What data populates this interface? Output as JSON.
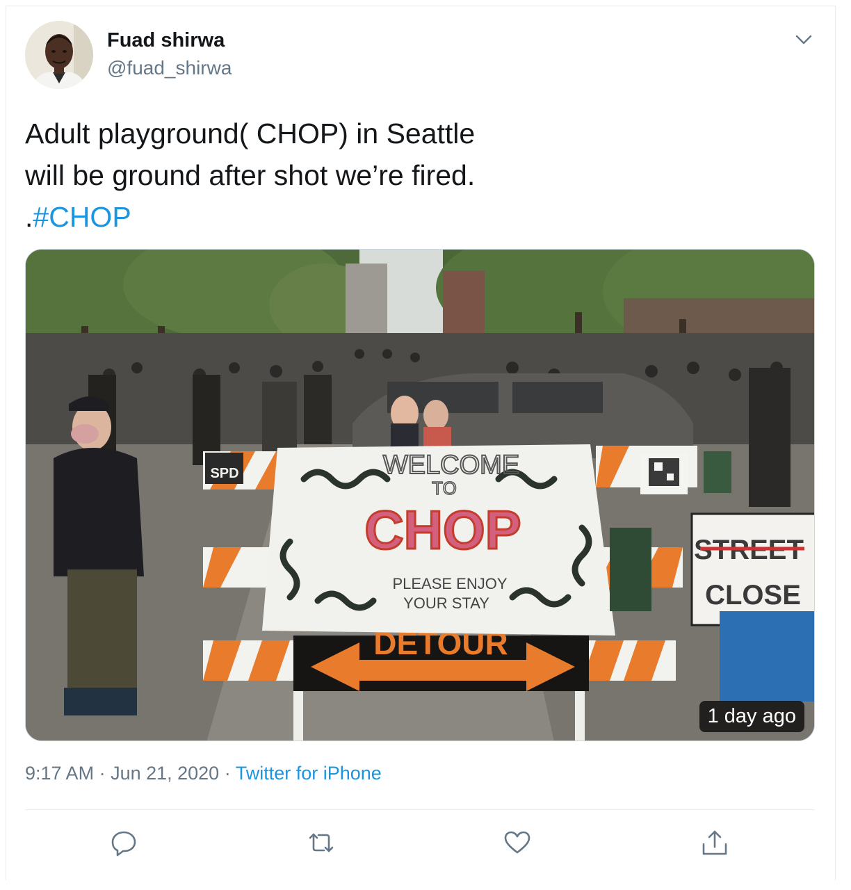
{
  "author": {
    "name": "Fuad shirwa",
    "handle": "@fuad_shirwa"
  },
  "tweet": {
    "text_line1": "Adult playground( CHOP) in Seattle",
    "text_line2": "will be ground after shot we’re fired.",
    "text_prefix": ".",
    "hashtag": "#CHOP"
  },
  "media": {
    "age_badge": "1 day ago",
    "sign": {
      "welcome": "WELCOME",
      "to": "TO",
      "chop": "CHOP",
      "please": "PLEASE ENJOY",
      "stay": "YOUR STAY",
      "detour": "DETOUR",
      "spd": "SPD",
      "street": "STREET",
      "closed": "CLOSE"
    }
  },
  "meta": {
    "time": "9:17 AM",
    "sep1": " · ",
    "date": "Jun 21, 2020",
    "sep2": " · ",
    "source": "Twitter for iPhone"
  },
  "colors": {
    "link": "#1b95e0",
    "secondary": "#657786",
    "border": "#e6ecf0"
  },
  "icons": [
    "reply-icon",
    "retweet-icon",
    "like-icon",
    "share-icon",
    "chevron-down-icon"
  ]
}
